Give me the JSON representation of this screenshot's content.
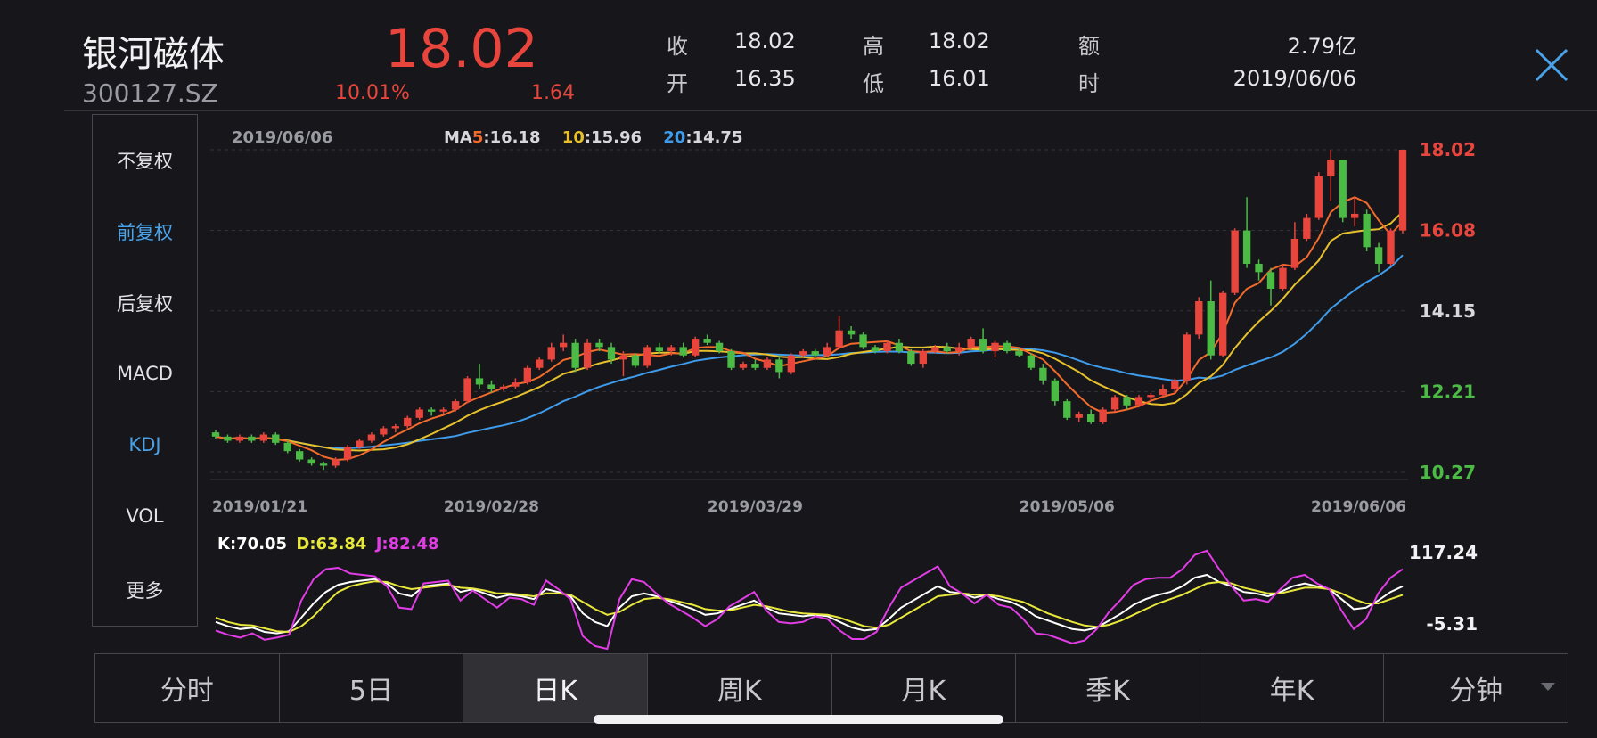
{
  "header": {
    "name": "银河磁体",
    "code": "300127.SZ",
    "price": "18.02",
    "change_pct": "10.01%",
    "change_amt": "1.64",
    "quote": [
      {
        "label": "收",
        "value": "18.02"
      },
      {
        "label": "开",
        "value": "16.35"
      },
      {
        "label": "高",
        "value": "18.02"
      },
      {
        "label": "低",
        "value": "16.01"
      },
      {
        "label": "额",
        "value": "2.79亿"
      },
      {
        "label": "时",
        "value": "2019/06/06"
      }
    ]
  },
  "side_menu": [
    {
      "label": "不复权",
      "active": false
    },
    {
      "label": "前复权",
      "active": true
    },
    {
      "label": "后复权",
      "active": false
    },
    {
      "label": "MACD",
      "active": false
    },
    {
      "label": "KDJ",
      "active": true
    },
    {
      "label": "VOL",
      "active": false
    },
    {
      "label": "更多",
      "active": false
    }
  ],
  "tabs": [
    {
      "label": "分时",
      "active": false
    },
    {
      "label": "5日",
      "active": false
    },
    {
      "label": "日K",
      "active": true
    },
    {
      "label": "周K",
      "active": false
    },
    {
      "label": "月K",
      "active": false
    },
    {
      "label": "季K",
      "active": false
    },
    {
      "label": "年K",
      "active": false
    },
    {
      "label": "分钟",
      "active": false
    }
  ],
  "icons": {
    "close": "close-icon",
    "dropdown": "dropdown-triangle-icon"
  },
  "colors": {
    "up": "#e8453c",
    "down": "#4cbb45",
    "ma5": "#f26b2c",
    "ma10": "#e7c12c",
    "ma20": "#3f9cec",
    "k": "#ffffff",
    "d": "#e8e83c",
    "j": "#e23ce6"
  },
  "chart_data": [
    {
      "type": "candlestick",
      "legend": {
        "date": "2019/06/06",
        "ma_prefix": "MA",
        "ma5_label": "5",
        "ma5_value": ":16.18",
        "ma10_label": "10",
        "ma10_value": ":15.96",
        "ma20_label": "20",
        "ma20_value": ":14.75"
      },
      "y_ticks": [
        {
          "value": 18.02,
          "label": "18.02",
          "color": "#e8453c"
        },
        {
          "value": 16.08,
          "label": "16.08",
          "color": "#e8453c"
        },
        {
          "value": 14.15,
          "label": "14.15",
          "color": "#d8d8dc"
        },
        {
          "value": 12.21,
          "label": "12.21",
          "color": "#4cbb45"
        },
        {
          "value": 10.27,
          "label": "10.27",
          "color": "#4cbb45"
        }
      ],
      "ylim": [
        10.27,
        18.02
      ],
      "x_ticks": [
        {
          "index": 0,
          "label": "2019/01/21"
        },
        {
          "index": 23,
          "label": "2019/02/28"
        },
        {
          "index": 45,
          "label": "2019/03/29"
        },
        {
          "index": 71,
          "label": "2019/05/06"
        },
        {
          "index": 91,
          "label": "2019/06/06"
        }
      ],
      "candles": [
        [
          11.23,
          11.13,
          11.28,
          11.08
        ],
        [
          11.13,
          11.03,
          11.18,
          10.98
        ],
        [
          11.03,
          11.13,
          11.18,
          10.98
        ],
        [
          11.13,
          11.03,
          11.18,
          10.98
        ],
        [
          11.03,
          11.18,
          11.23,
          10.98
        ],
        [
          11.18,
          10.98,
          11.23,
          10.93
        ],
        [
          10.98,
          10.78,
          11.03,
          10.73
        ],
        [
          10.78,
          10.58,
          10.83,
          10.53
        ],
        [
          10.58,
          10.48,
          10.63,
          10.43
        ],
        [
          10.48,
          10.43,
          10.53,
          10.33
        ],
        [
          10.43,
          10.58,
          10.63,
          10.38
        ],
        [
          10.58,
          10.88,
          10.93,
          10.53
        ],
        [
          10.88,
          11.03,
          11.08,
          10.83
        ],
        [
          11.03,
          11.18,
          11.23,
          10.98
        ],
        [
          11.18,
          11.33,
          11.38,
          11.13
        ],
        [
          11.33,
          11.38,
          11.43,
          11.23
        ],
        [
          11.38,
          11.58,
          11.63,
          11.33
        ],
        [
          11.58,
          11.78,
          11.83,
          11.53
        ],
        [
          11.78,
          11.73,
          11.83,
          11.63
        ],
        [
          11.73,
          11.78,
          11.83,
          11.68
        ],
        [
          11.78,
          11.98,
          12.03,
          11.73
        ],
        [
          11.98,
          12.53,
          12.58,
          11.93
        ],
        [
          12.53,
          12.38,
          12.88,
          12.28
        ],
        [
          12.38,
          12.28,
          12.48,
          12.18
        ],
        [
          12.28,
          12.33,
          12.38,
          12.23
        ],
        [
          12.33,
          12.43,
          12.53,
          12.28
        ],
        [
          12.43,
          12.78,
          12.83,
          12.38
        ],
        [
          12.78,
          12.98,
          13.03,
          12.73
        ],
        [
          12.98,
          13.28,
          13.38,
          12.93
        ],
        [
          13.28,
          13.38,
          13.58,
          13.18
        ],
        [
          13.38,
          12.78,
          13.48,
          12.68
        ],
        [
          12.78,
          13.38,
          13.48,
          12.73
        ],
        [
          13.38,
          13.28,
          13.48,
          13.18
        ],
        [
          13.28,
          12.98,
          13.38,
          12.88
        ],
        [
          12.98,
          13.08,
          13.18,
          12.58
        ],
        [
          13.08,
          12.83,
          13.13,
          12.78
        ],
        [
          12.83,
          13.28,
          13.33,
          12.78
        ],
        [
          13.28,
          13.18,
          13.38,
          13.13
        ],
        [
          13.18,
          13.28,
          13.33,
          13.08
        ],
        [
          13.28,
          13.08,
          13.38,
          13.03
        ],
        [
          13.08,
          13.48,
          13.53,
          13.03
        ],
        [
          13.48,
          13.38,
          13.58,
          13.33
        ],
        [
          13.38,
          13.18,
          13.43,
          13.13
        ],
        [
          13.18,
          12.78,
          13.23,
          12.73
        ],
        [
          12.78,
          12.88,
          12.93,
          12.73
        ],
        [
          12.88,
          12.78,
          12.98,
          12.73
        ],
        [
          12.78,
          12.98,
          13.03,
          12.73
        ],
        [
          12.98,
          12.68,
          13.08,
          12.53
        ],
        [
          12.68,
          13.08,
          13.13,
          12.63
        ],
        [
          13.08,
          13.18,
          13.23,
          13.03
        ],
        [
          13.18,
          13.08,
          13.23,
          13.03
        ],
        [
          13.08,
          13.28,
          13.38,
          13.03
        ],
        [
          13.28,
          13.68,
          14.03,
          13.23
        ],
        [
          13.68,
          13.58,
          13.78,
          13.48
        ],
        [
          13.58,
          13.28,
          13.63,
          13.23
        ],
        [
          13.28,
          13.18,
          13.33,
          13.13
        ],
        [
          13.18,
          13.38,
          13.43,
          13.13
        ],
        [
          13.38,
          13.18,
          13.48,
          13.13
        ],
        [
          13.18,
          12.88,
          13.23,
          12.83
        ],
        [
          12.88,
          13.18,
          13.23,
          12.78
        ],
        [
          13.18,
          13.28,
          13.33,
          13.13
        ],
        [
          13.28,
          13.18,
          13.38,
          13.13
        ],
        [
          13.18,
          13.28,
          13.38,
          13.08
        ],
        [
          13.28,
          13.48,
          13.53,
          13.23
        ],
        [
          13.48,
          13.18,
          13.73,
          13.13
        ],
        [
          13.18,
          13.38,
          13.43,
          13.03
        ],
        [
          13.38,
          13.18,
          13.43,
          13.13
        ],
        [
          13.18,
          13.08,
          13.23,
          13.03
        ],
        [
          13.08,
          12.78,
          13.13,
          12.73
        ],
        [
          12.78,
          12.48,
          12.88,
          12.38
        ],
        [
          12.48,
          11.98,
          12.53,
          11.88
        ],
        [
          11.98,
          11.58,
          12.03,
          11.53
        ],
        [
          11.58,
          11.68,
          11.73,
          11.48
        ],
        [
          11.68,
          11.48,
          11.78,
          11.43
        ],
        [
          11.48,
          11.78,
          11.83,
          11.43
        ],
        [
          11.78,
          12.08,
          12.13,
          11.73
        ],
        [
          12.08,
          11.88,
          12.13,
          11.78
        ],
        [
          11.88,
          12.08,
          12.13,
          11.83
        ],
        [
          12.08,
          12.13,
          12.18,
          11.98
        ],
        [
          12.13,
          12.28,
          12.38,
          12.08
        ],
        [
          12.28,
          12.48,
          12.53,
          12.18
        ],
        [
          12.48,
          13.58,
          13.63,
          12.38
        ],
        [
          13.58,
          14.38,
          14.48,
          13.48
        ],
        [
          14.38,
          13.08,
          14.88,
          12.98
        ],
        [
          13.08,
          14.58,
          14.63,
          13.03
        ],
        [
          14.58,
          16.08,
          16.13,
          14.53
        ],
        [
          16.08,
          15.28,
          16.88,
          15.18
        ],
        [
          15.28,
          15.08,
          15.38,
          14.88
        ],
        [
          15.08,
          14.68,
          15.18,
          14.28
        ],
        [
          14.68,
          15.18,
          15.28,
          14.63
        ],
        [
          15.18,
          15.88,
          16.28,
          15.13
        ],
        [
          15.88,
          16.38,
          16.48,
          15.83
        ],
        [
          16.38,
          17.38,
          17.48,
          16.33
        ],
        [
          17.38,
          17.78,
          18.02,
          16.78
        ],
        [
          17.78,
          16.38,
          17.58,
          16.28
        ],
        [
          16.38,
          16.48,
          16.88,
          16.18
        ],
        [
          16.48,
          15.68,
          16.58,
          15.58
        ],
        [
          15.68,
          15.28,
          15.78,
          15.08
        ],
        [
          15.28,
          16.08,
          16.13,
          15.23
        ],
        [
          16.08,
          18.02,
          18.02,
          16.01
        ]
      ]
    },
    {
      "type": "line",
      "legend": {
        "k": "K:70.05",
        "d": "D:63.84",
        "j": "J:82.48"
      },
      "y_ticks": [
        {
          "value": 117.24,
          "label": "117.24"
        },
        {
          "value": -5.31,
          "label": "-5.31"
        }
      ],
      "ylim": [
        -5.31,
        117.24
      ],
      "series": [
        {
          "name": "K",
          "values": [
            20,
            14,
            10,
            12,
            6,
            4,
            7,
            26,
            46,
            62,
            72,
            76,
            78,
            80,
            74,
            60,
            56,
            70,
            72,
            74,
            62,
            66,
            60,
            54,
            58,
            56,
            52,
            66,
            62,
            56,
            32,
            20,
            14,
            40,
            56,
            60,
            56,
            50,
            44,
            38,
            30,
            32,
            38,
            44,
            50,
            40,
            32,
            30,
            28,
            30,
            28,
            20,
            12,
            8,
            10,
            24,
            40,
            50,
            60,
            70,
            62,
            60,
            54,
            58,
            52,
            48,
            40,
            28,
            22,
            16,
            10,
            8,
            12,
            22,
            32,
            44,
            52,
            58,
            62,
            70,
            82,
            86,
            76,
            70,
            62,
            60,
            56,
            62,
            70,
            74,
            70,
            66,
            52,
            38,
            40,
            50,
            62,
            70
          ]
        },
        {
          "name": "D",
          "values": [
            26,
            20,
            16,
            15,
            11,
            7,
            6,
            14,
            28,
            46,
            62,
            70,
            74,
            77,
            76,
            70,
            66,
            68,
            70,
            72,
            68,
            67,
            64,
            60,
            60,
            58,
            56,
            60,
            60,
            58,
            48,
            38,
            30,
            34,
            44,
            52,
            54,
            52,
            48,
            44,
            38,
            36,
            36,
            40,
            44,
            42,
            38,
            34,
            32,
            31,
            30,
            26,
            20,
            14,
            12,
            16,
            26,
            36,
            46,
            56,
            58,
            60,
            58,
            58,
            56,
            52,
            48,
            40,
            32,
            26,
            20,
            15,
            13,
            16,
            22,
            30,
            38,
            46,
            52,
            58,
            66,
            74,
            76,
            74,
            68,
            64,
            60,
            60,
            64,
            68,
            68,
            66,
            60,
            52,
            46,
            46,
            52,
            58
          ]
        },
        {
          "name": "J",
          "values": [
            8,
            2,
            -2,
            4,
            -5,
            -2,
            2,
            50,
            80,
            94,
            96,
            88,
            86,
            84,
            70,
            40,
            38,
            74,
            76,
            78,
            50,
            64,
            52,
            40,
            54,
            52,
            44,
            78,
            66,
            52,
            0,
            -14,
            -18,
            52,
            80,
            76,
            60,
            46,
            36,
            26,
            14,
            24,
            42,
            52,
            62,
            36,
            20,
            18,
            20,
            28,
            24,
            8,
            -4,
            -4,
            6,
            40,
            68,
            78,
            88,
            98,
            70,
            60,
            46,
            58,
            44,
            40,
            24,
            4,
            2,
            -4,
            -10,
            -6,
            10,
            34,
            52,
            72,
            80,
            82,
            82,
            94,
            114,
            120,
            94,
            70,
            50,
            52,
            48,
            66,
            82,
            86,
            74,
            66,
            36,
            10,
            24,
            60,
            82,
            94
          ]
        }
      ]
    }
  ]
}
